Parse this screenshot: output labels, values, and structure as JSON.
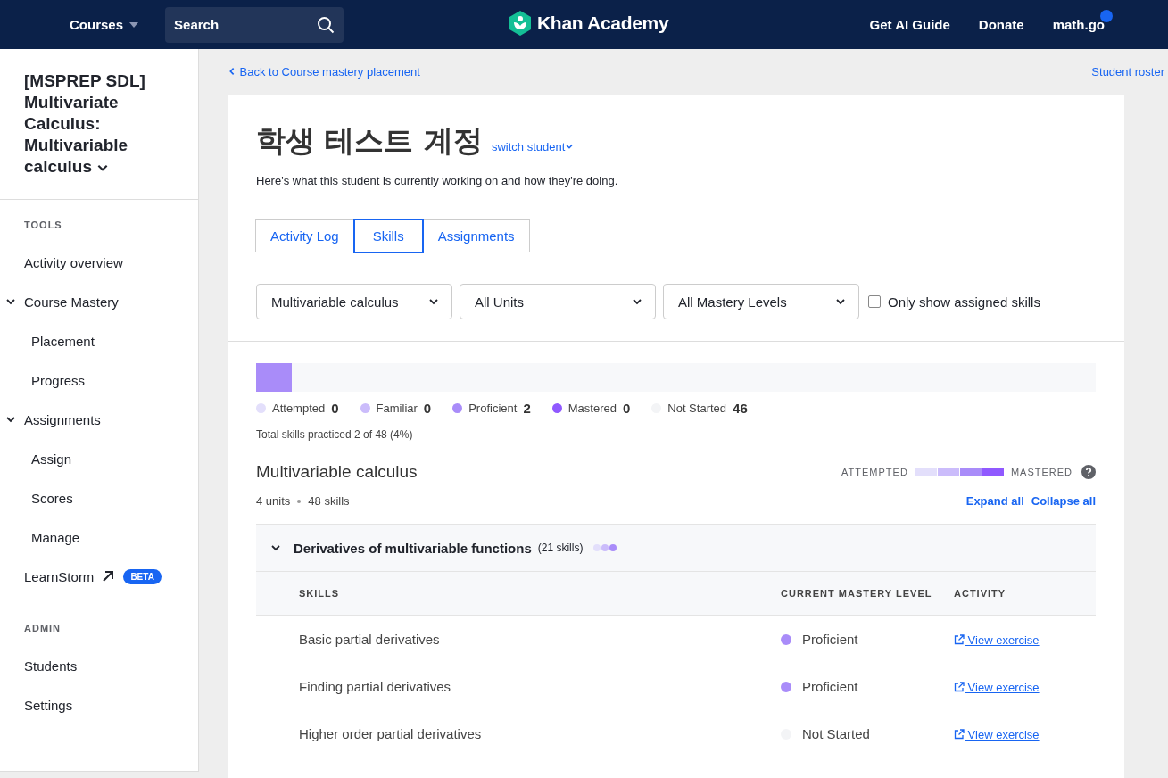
{
  "header": {
    "courses_menu": "Courses",
    "search": {
      "placeholder": "Search"
    },
    "logo_text": "Khan Academy",
    "links": [
      "Get AI Guide",
      "Donate"
    ],
    "user": "math.go"
  },
  "sidebar": {
    "course_title": "[MSPREP SDL] Multivariate Calculus: Multivariable calculus",
    "sections": [
      {
        "heading": "TOOLS",
        "items": [
          {
            "label": "Activity overview"
          },
          {
            "label": "Course Mastery",
            "kind": "group",
            "expanded": true,
            "children": [
              {
                "label": "Placement"
              },
              {
                "label": "Progress"
              }
            ]
          },
          {
            "label": "Assignments",
            "kind": "group",
            "expanded": true,
            "children": [
              {
                "label": "Assign"
              },
              {
                "label": "Scores"
              },
              {
                "label": "Manage"
              }
            ]
          },
          {
            "label": "LearnStorm",
            "kind": "external",
            "badge": "BETA"
          }
        ]
      },
      {
        "heading": "ADMIN",
        "items": [
          {
            "label": "Students"
          },
          {
            "label": "Settings"
          }
        ]
      }
    ]
  },
  "back_link": "Back to Course mastery placement",
  "roster_link": "Student roster",
  "student": {
    "name": "학생 테스트 계정",
    "switch": "switch student",
    "description": "Here's what this student is currently working on and how they're doing."
  },
  "tabs": [
    {
      "label": "Activity Log",
      "selected": false
    },
    {
      "label": "Skills",
      "selected": true
    },
    {
      "label": "Assignments",
      "selected": false
    }
  ],
  "filters": [
    {
      "value": "Multivariable calculus"
    },
    {
      "value": "All Units"
    },
    {
      "value": "All Mastery Levels"
    }
  ],
  "assigned_only": {
    "label": "Only show assigned skills",
    "checked": false
  },
  "progress_bar": {
    "level": 0.042
  },
  "legend": [
    {
      "label": "Attempted",
      "count": "0",
      "color": "#e3dffb"
    },
    {
      "label": "Familiar",
      "count": "0",
      "color": "#cbbcfb"
    },
    {
      "label": "Proficient",
      "count": "2",
      "color": "#a98cf9"
    },
    {
      "label": "Mastered",
      "count": "0",
      "color": "#9059ff"
    },
    {
      "label": "Not Started",
      "count": "46",
      "color": "#f3f4f6"
    }
  ],
  "total_practiced": "Total skills practiced 2 of 48 (4%)",
  "course": {
    "title": "Multivariable calculus",
    "units": "4 units",
    "skills": "48 skills",
    "scale_start": "ATTEMPTED",
    "scale_end": "MASTERED",
    "expand_all": "Expand all",
    "collapse_all": "Collapse all"
  },
  "unit": {
    "title": "Derivatives of multivariable functions",
    "count": "(21 skills)",
    "expanded": true,
    "columns": [
      "SKILLS",
      "CURRENT MASTERY LEVEL",
      "ACTIVITY"
    ],
    "rows": [
      {
        "skill": "Basic partial derivatives",
        "level": "Proficient",
        "color": "#a98cf9",
        "activity": "View exercise"
      },
      {
        "skill": "Finding partial derivatives",
        "level": "Proficient",
        "color": "#a98cf9",
        "activity": "View exercise"
      },
      {
        "skill": "Higher order partial derivatives",
        "level": "Not Started",
        "color": "#f3f4f6",
        "activity": "View exercise"
      }
    ]
  }
}
